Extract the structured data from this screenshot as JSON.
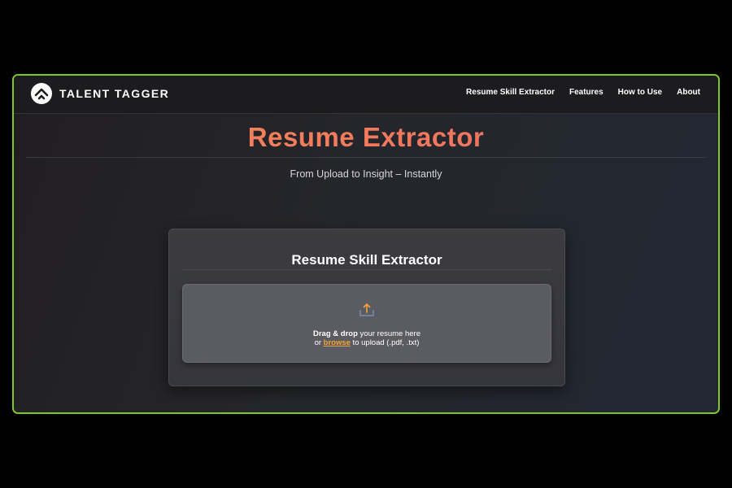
{
  "brand": {
    "name": "TALENT TAGGER",
    "logo_icon": "chevron-up-logo-icon"
  },
  "nav": {
    "links": [
      {
        "label": "Resume Skill Extractor"
      },
      {
        "label": "Features"
      },
      {
        "label": "How to Use"
      },
      {
        "label": "About"
      }
    ]
  },
  "hero": {
    "title": "Resume Extractor",
    "subtitle": "From Upload to Insight – Instantly"
  },
  "card": {
    "title": "Resume Skill Extractor",
    "dropzone": {
      "icon": "upload-icon",
      "line1_bold": "Drag & drop",
      "line1_rest": " your resume here",
      "line2_prefix": "or ",
      "browse_label": "browse",
      "line2_suffix": " to upload (.pdf, .txt)"
    }
  },
  "colors": {
    "frame_border": "#7ec62a",
    "title_gradient_start": "#f58a58",
    "title_gradient_end": "#ee6a62",
    "browse_link": "#f0a33a"
  }
}
